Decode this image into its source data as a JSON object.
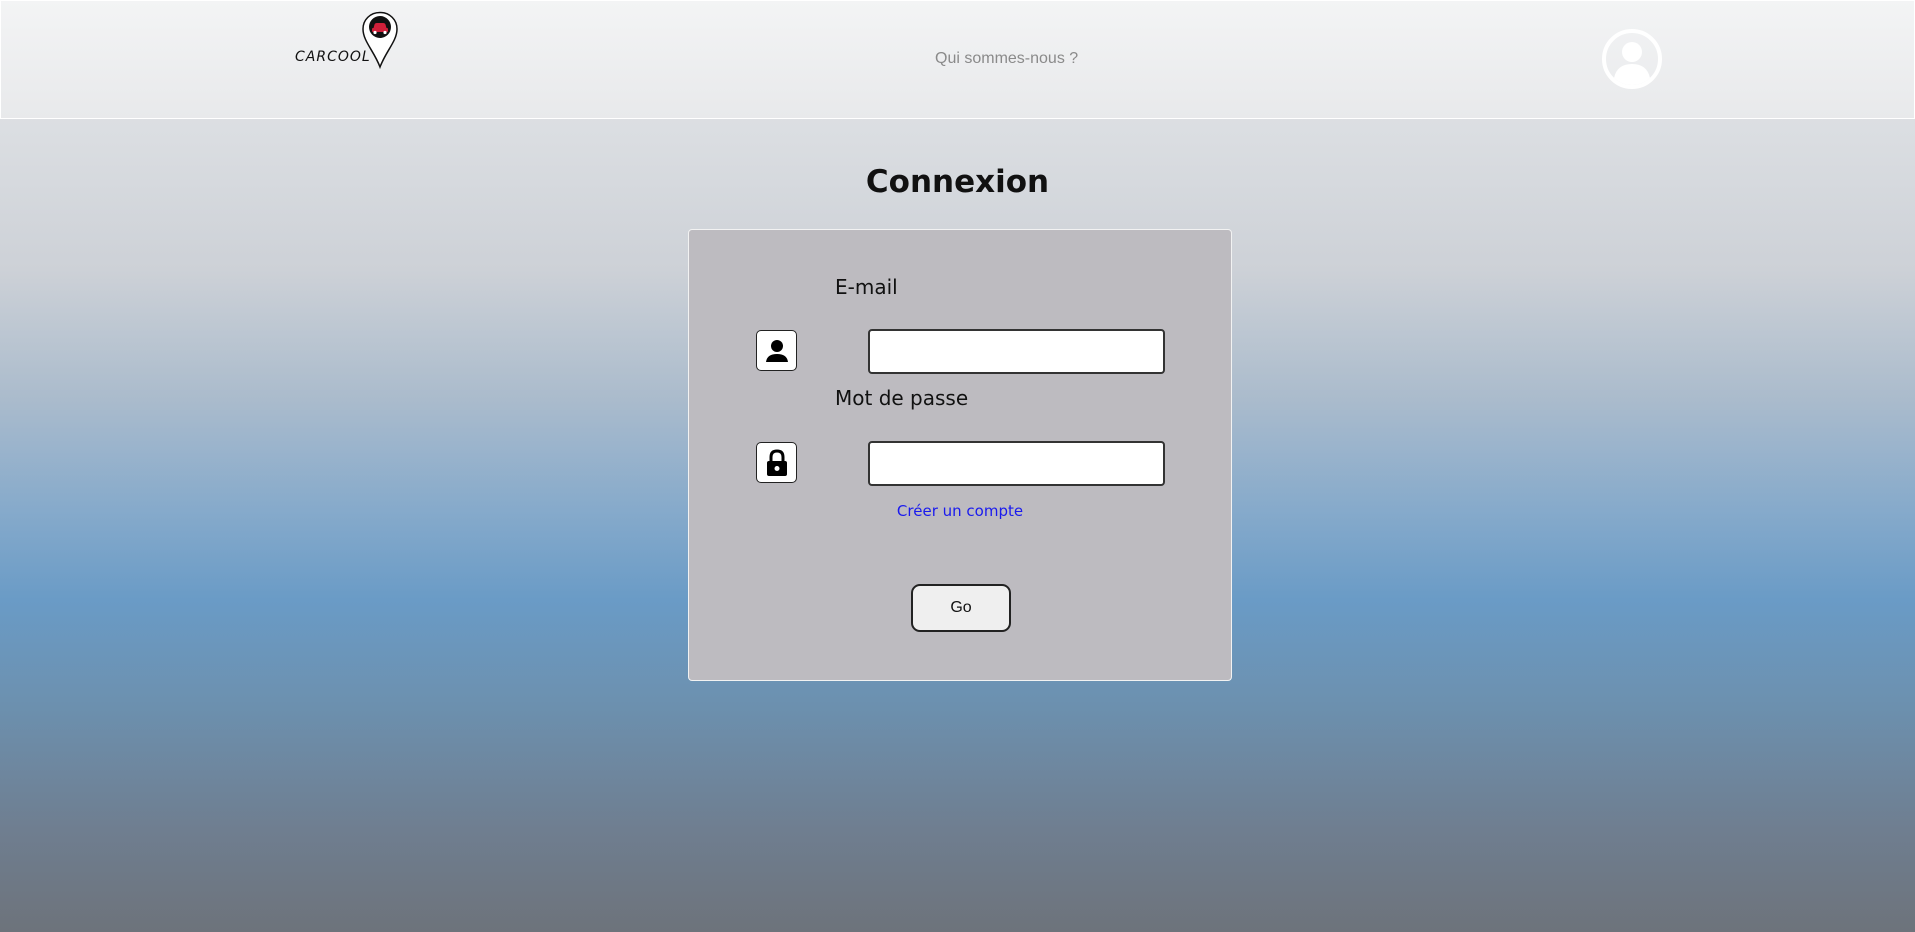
{
  "header": {
    "logo_text": "CARCOOL",
    "nav_link": "Qui sommes-nous ?"
  },
  "main": {
    "title": "Connexion",
    "form": {
      "email_label": "E-mail",
      "email_value": "",
      "password_label": "Mot de passe",
      "password_value": "",
      "create_account": "Créer un compte",
      "submit": "Go"
    }
  },
  "icons": {
    "logo": "map-pin-car-icon",
    "account": "user-avatar-icon",
    "email": "person-icon",
    "password": "lock-icon"
  },
  "colors": {
    "link": "#1a1aee",
    "card": "#bdbbc0",
    "logo_red": "#d0203a"
  }
}
